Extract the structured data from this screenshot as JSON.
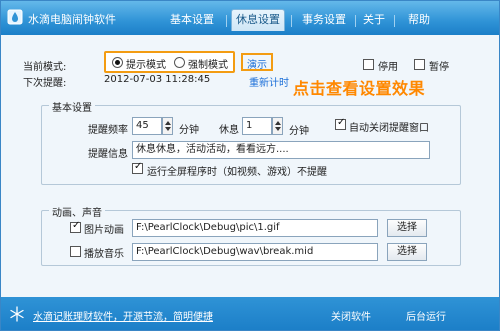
{
  "window": {
    "title": "水滴电脑闹钟软件"
  },
  "tabs": [
    {
      "label": "基本设置",
      "active": false
    },
    {
      "label": "休息设置",
      "active": true
    },
    {
      "label": "事务设置",
      "active": false
    },
    {
      "label": "关于",
      "active": false
    },
    {
      "label": "帮助",
      "active": false
    }
  ],
  "mode": {
    "label": "当前模式:",
    "option_prompt": "提示模式",
    "option_force": "强制模式",
    "selected": "提示模式",
    "demo_link": "演示",
    "recount_link": "重新计时",
    "next_label": "下次提醒:",
    "next_value": "2012-07-03 11:28:45",
    "disable_label": "停用",
    "disable_checked": false,
    "pause_label": "暂停",
    "pause_checked": false
  },
  "annotation": "点击查看设置效果",
  "basic": {
    "legend": "基本设置",
    "freq_label": "提醒频率",
    "freq_value": "45",
    "freq_unit": "分钟",
    "rest_label": "休息",
    "rest_value": "1",
    "rest_unit": "分钟",
    "autoclose_label": "自动关闭提醒窗口",
    "autoclose_checked": true,
    "info_label": "提醒信息",
    "info_value": "休息休息，活动活动，看看远方....",
    "fullscreen_label": "运行全屏程序时（如视频、游戏）不提醒",
    "fullscreen_checked": true
  },
  "media": {
    "legend": "动画、声音",
    "pic_label": "图片动画",
    "pic_checked": true,
    "pic_path": "F:\\PearlClock\\Debug\\pic\\1.gif",
    "pic_button": "选择",
    "music_label": "播放音乐",
    "music_checked": false,
    "music_path": "F:\\PearlClock\\Debug\\wav\\break.mid",
    "music_button": "选择"
  },
  "footer": {
    "link": "水滴记账理财软件，开源节流，简明便捷",
    "close_label": "关闭软件",
    "background_label": "后台运行"
  },
  "colors": {
    "accent": "#2f93d6",
    "highlight": "#f39c12",
    "annotation": "#ff8800"
  }
}
